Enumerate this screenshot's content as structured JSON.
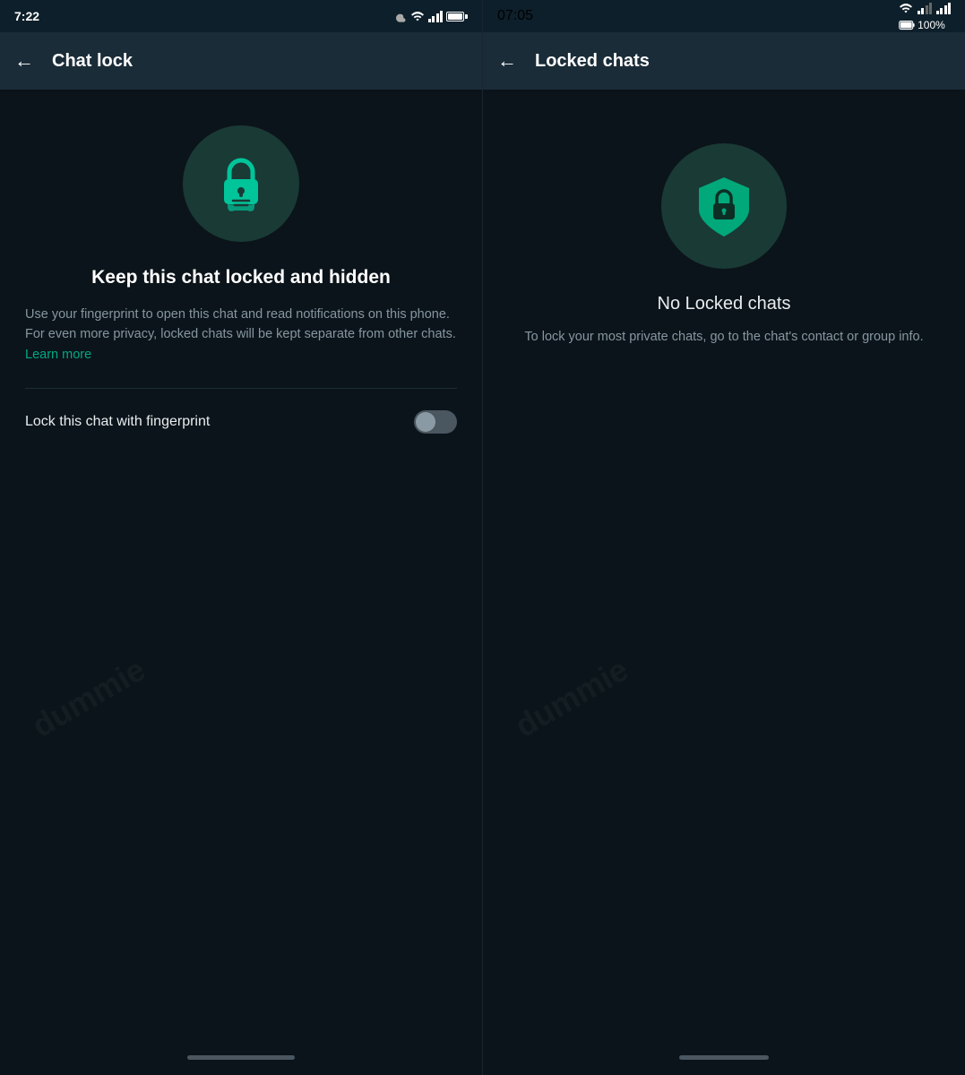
{
  "left_panel": {
    "status_bar": {
      "time": "7:22",
      "cloud_icon": "cloud-icon",
      "wifi_icon": "wifi-icon",
      "signal_icon": "signal-icon",
      "battery_icon": "battery-icon"
    },
    "header": {
      "back_label": "←",
      "title": "Chat lock"
    },
    "icon_alt": "chat-lock-icon",
    "main_title": "Keep this chat locked and hidden",
    "description": "Use your fingerprint to open this chat and read notifications on this phone. For even more privacy, locked chats will be kept separate from other chats.",
    "learn_more": "Learn more",
    "toggle_label": "Lock this chat with fingerprint",
    "toggle_state": false,
    "watermark": "dummie"
  },
  "right_panel": {
    "status_bar": {
      "time": "07:05",
      "wifi_icon": "wifi-icon",
      "signal_icon": "signal-icon",
      "battery_text": "100%"
    },
    "header": {
      "back_label": "←",
      "title": "Locked chats"
    },
    "icon_alt": "locked-shield-icon",
    "no_locked_title": "No Locked chats",
    "no_locked_desc": "To lock your most private chats, go to the chat's contact or group info.",
    "watermark": "dummie"
  }
}
